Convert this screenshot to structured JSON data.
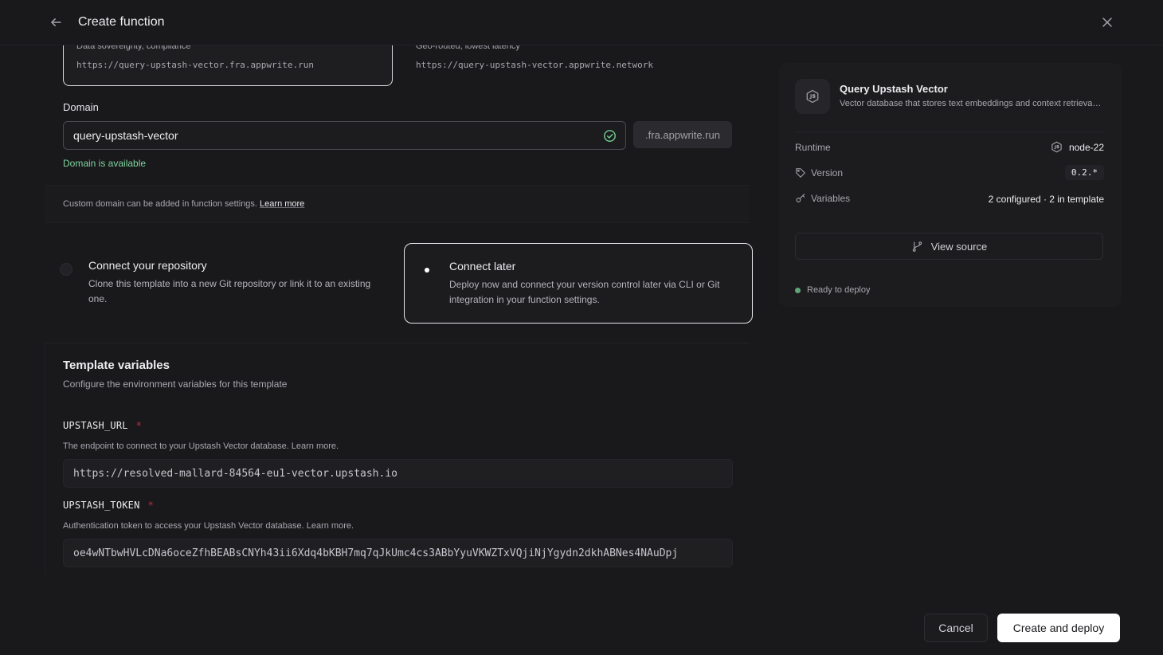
{
  "header": {
    "title": "Create function"
  },
  "regions": [
    {
      "description": "Data sovereignty, compliance",
      "url": "https://query-upstash-vector.fra.appwrite.run"
    },
    {
      "description": "Geo-routed, lowest latency",
      "url": "https://query-upstash-vector.appwrite.network"
    }
  ],
  "domain": {
    "label": "Domain",
    "value": "query-upstash-vector",
    "suffix": ".fra.appwrite.run",
    "status": "Domain is available"
  },
  "custom_domain": {
    "text": "Custom domain can be added in function settings.",
    "link": "Learn more"
  },
  "connect_options": [
    {
      "title": "Connect your repository",
      "description": "Clone this template into a new Git repository or link it to an existing one.",
      "selected": false
    },
    {
      "title": "Connect later",
      "description": "Deploy now and connect your version control later via CLI or Git integration in your function settings.",
      "selected": true
    }
  ],
  "template_variables": {
    "title": "Template variables",
    "description": "Configure the environment variables for this template",
    "required_mark": "*",
    "items": [
      {
        "name": "UPSTASH_URL",
        "description": "The endpoint to connect to your Upstash Vector database. Learn more.",
        "value": "https://resolved-mallard-84564-eu1-vector.upstash.io"
      },
      {
        "name": "UPSTASH_TOKEN",
        "description": "Authentication token to access your Upstash Vector database. Learn more.",
        "value": "oe4wNTbwHVLcDNa6oceZfhBEABsCNYh43ii6Xdq4bKBH7mq7qJkUmc4cs3ABbYyuVKWZTxVQjiNjYgydn2dkhABNes4NAuDpj"
      }
    ]
  },
  "summary": {
    "name": "Query Upstash Vector",
    "description": "Vector database that stores text embeddings and context retrieval for LLMs",
    "runtime_label": "Runtime",
    "runtime_value": "node-22",
    "version_label": "Version",
    "version_value": "0.2.*",
    "variables_label": "Variables",
    "variables_value": "2 configured · 2 in template",
    "view_source_label": "View source",
    "status": "Ready to deploy"
  },
  "footer": {
    "cancel_label": "Cancel",
    "create_label": "Create and deploy"
  },
  "colors": {
    "background": "#19191c",
    "success": "#7fd49c",
    "required": "#b5323f",
    "primary_button": "#ffffff"
  }
}
